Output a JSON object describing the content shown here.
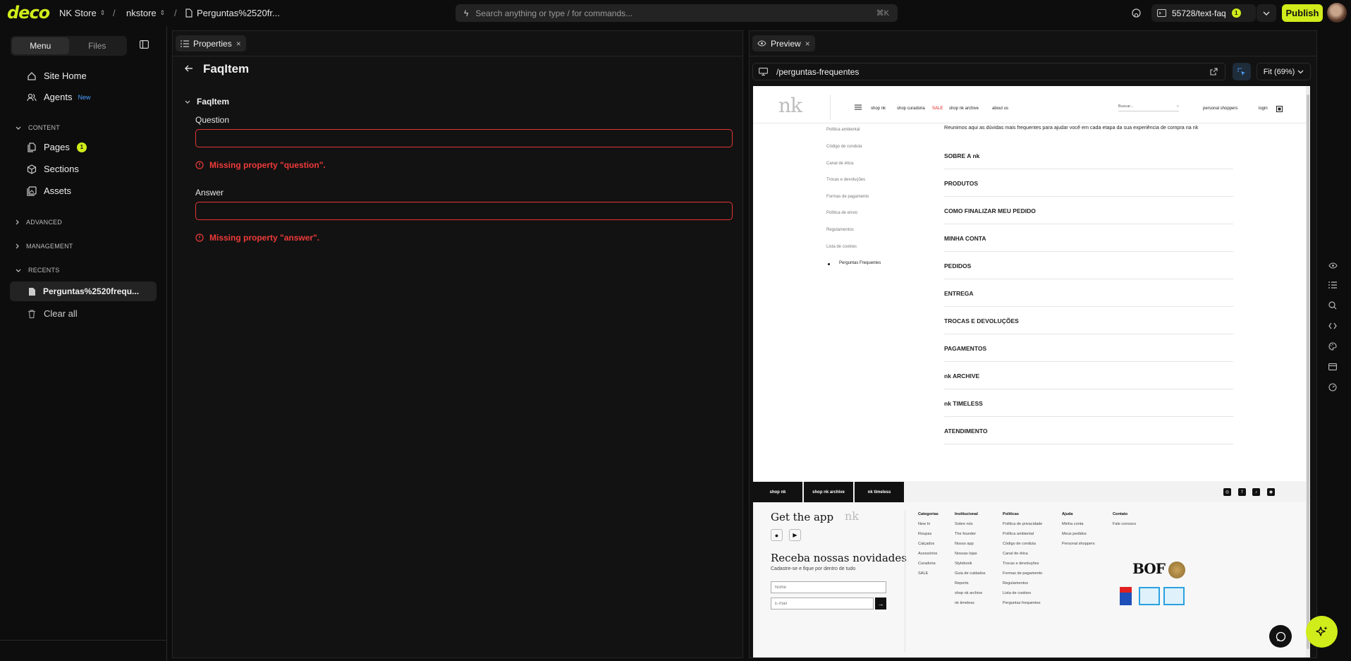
{
  "topbar": {
    "logo": "deco",
    "site": "NK Store",
    "env": "nkstore",
    "page": "Perguntas%2520fr...",
    "search_placeholder": "Search anything or type / for commands...",
    "search_shortcut": "⌘K",
    "branch": "55728/text-faq",
    "branch_badge": "1",
    "publish_label": "Publish"
  },
  "sidebar": {
    "tab_menu": "Menu",
    "tab_files": "Files",
    "site_home": "Site Home",
    "agents": "Agents",
    "agents_badge": "New",
    "content_heading": "CONTENT",
    "pages": "Pages",
    "pages_badge": "1",
    "sections": "Sections",
    "assets": "Assets",
    "advanced_heading": "ADVANCED",
    "management_heading": "MANAGEMENT",
    "recents_heading": "RECENTS",
    "recent_item": "Perguntas%2520frequ...",
    "clear_all": "Clear all"
  },
  "properties": {
    "tab_label": "Properties",
    "title": "FaqItem",
    "group_label": "FaqItem",
    "question_label": "Question",
    "question_value": "",
    "question_error": "Missing property \"question\".",
    "answer_label": "Answer",
    "answer_value": "",
    "answer_error": "Missing property \"answer\"."
  },
  "preview": {
    "tab_label": "Preview",
    "url": "/perguntas-frequentes",
    "zoom": "Fit (69%)"
  },
  "site": {
    "logo": "nk",
    "nav": [
      "shop nk",
      "shop curadoria",
      "SALE",
      "shop nk archive",
      "about us"
    ],
    "search_placeholder": "Buscar...",
    "personal_shoppers": "personal shoppers",
    "login": "login",
    "side_links": [
      "Política ambiental",
      "Código de conduta",
      "Canal de ética",
      "Trocas e devoluções",
      "Formas de pagamento",
      "Política de envio",
      "Regulamentos",
      "Lista de cookies",
      "Perguntas Frequentes"
    ],
    "intro": "Reunimos aqui as dúvidas mais frequentes para ajudar você em cada etapa da sua experiência de compra na nk",
    "faq": [
      "SOBRE A nk",
      "PRODUTOS",
      "COMO FINALIZAR MEU PEDIDO",
      "MINHA CONTA",
      "PEDIDOS",
      "ENTREGA",
      "TROCAS E DEVOLUÇÕES",
      "PAGAMENTOS",
      "nk ARCHIVE",
      "nk TIMELESS",
      "ATENDIMENTO"
    ],
    "footer_tabs": [
      "shop nk",
      "shop nk archive",
      "nk timeless"
    ],
    "get_app": "Get the app",
    "newsletter_title": "Receba nossas novidades",
    "newsletter_sub": "Cadastre-se e fique por dentro de tudo",
    "name_placeholder": "Nome",
    "email_placeholder": "E-mail",
    "columns": [
      {
        "title": "Categorias",
        "items": [
          "New In",
          "Roupas",
          "Calçados",
          "Acessórios",
          "Curadoria",
          "SALE"
        ]
      },
      {
        "title": "Institucional",
        "items": [
          "Sobre nós",
          "The founder",
          "Nosso app",
          "Nossas lojas",
          "Stylebook",
          "Guia de cuidados",
          "Reports",
          "shop nk archive",
          "nk timeless"
        ]
      },
      {
        "title": "Políticas",
        "items": [
          "Política de privacidade",
          "Política ambiental",
          "Código de conduta",
          "Canal de ética",
          "Trocas e devoluções",
          "Formas de pagamento",
          "Regulamentos",
          "Lista de cookies",
          "Perguntas frequentes"
        ]
      },
      {
        "title": "Ajuda",
        "items": [
          "Minha conta",
          "Meus pedidos",
          "Personal shoppers"
        ]
      },
      {
        "title": "Contato",
        "items": [
          "Fale conosco"
        ]
      }
    ],
    "bof": "BOF"
  },
  "colors": {
    "accent": "#d0ec1a",
    "error": "#ef3a3a",
    "sale": "#e02020"
  }
}
